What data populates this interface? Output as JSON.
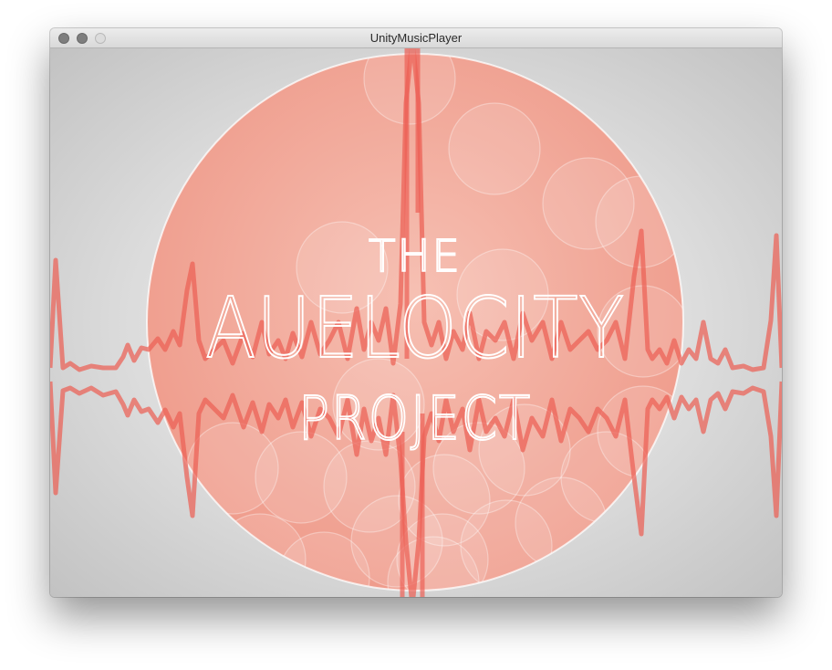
{
  "window": {
    "title": "UnityMusicPlayer"
  },
  "artwork": {
    "line1": "THE",
    "line2": "AUELOCITY",
    "line3": "PROJECT"
  },
  "colors": {
    "disc": "#f0a596",
    "waveform": "#ec5f55",
    "text": "#ffffff"
  },
  "icons": {
    "close": "close-button",
    "minimize": "minimize-button",
    "zoom": "zoom-button"
  }
}
